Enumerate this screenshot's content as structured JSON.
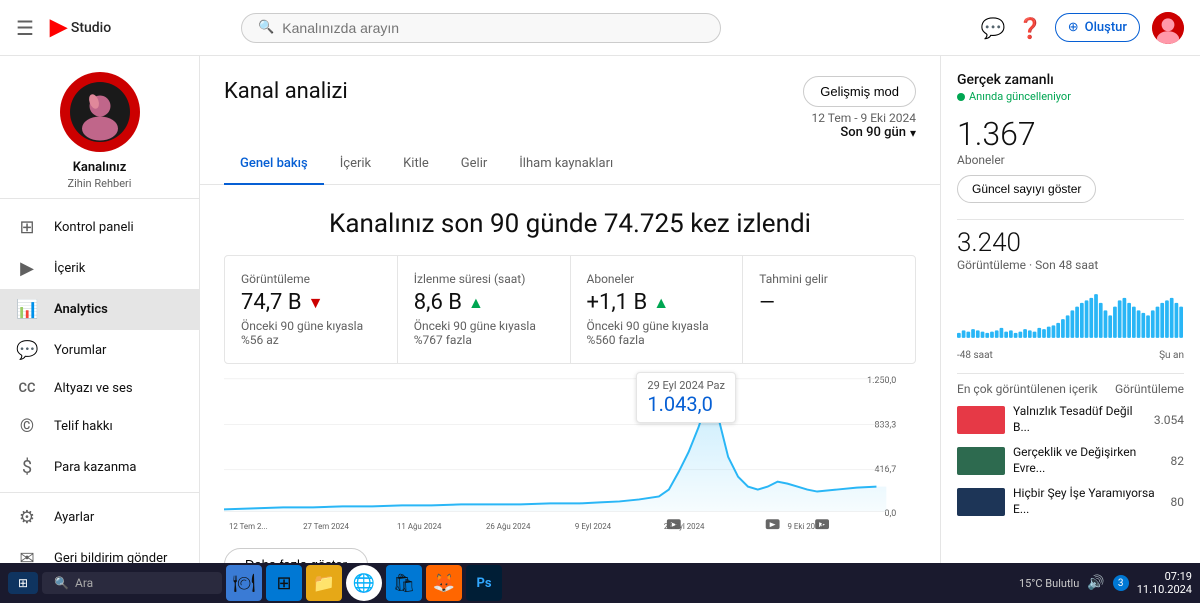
{
  "topbar": {
    "search_placeholder": "Kanalınızda arayın",
    "create_label": "Oluştur",
    "messages_icon": "💬",
    "help_icon": "?",
    "create_icon": "+"
  },
  "sidebar": {
    "channel_name": "Kanalınız",
    "channel_sub": "Zihin Rehberi",
    "items": [
      {
        "id": "dashboard",
        "label": "Kontrol paneli",
        "icon": "⊞"
      },
      {
        "id": "content",
        "label": "İçerik",
        "icon": "▶"
      },
      {
        "id": "analytics",
        "label": "Analytics",
        "icon": "📊"
      },
      {
        "id": "comments",
        "label": "Yorumlar",
        "icon": "💬"
      },
      {
        "id": "subtitles",
        "label": "Altyazı ve ses",
        "icon": "CC"
      },
      {
        "id": "copyright",
        "label": "Telif hakkı",
        "icon": "©"
      },
      {
        "id": "monetization",
        "label": "Para kazanma",
        "icon": "$"
      },
      {
        "id": "settings",
        "label": "Ayarlar",
        "icon": "⚙"
      },
      {
        "id": "feedback",
        "label": "Geri bildirim gönder",
        "icon": "✉"
      }
    ]
  },
  "analytics": {
    "title": "Kanal analizi",
    "advanced_btn": "Gelişmiş mod",
    "tabs": [
      "Genel bakış",
      "İçerik",
      "Kitle",
      "Gelir",
      "İlham kaynakları"
    ],
    "active_tab": "Genel bakış",
    "date_range_label": "12 Tem - 9 Eki 2024",
    "date_range_value": "Son 90 gün",
    "headline": "Kanalınız son 90 günde 74.725 kez izlendi",
    "stats": [
      {
        "label": "Görüntüleme",
        "value": "74,7 B",
        "badge": "down",
        "change": "Önceki 90 güne kıyasla %56 az"
      },
      {
        "label": "İzlenme süresi (saat)",
        "value": "8,6 B",
        "badge": "up",
        "change": "Önceki 90 güne kıyasla %767 fazla"
      },
      {
        "label": "Aboneler",
        "value": "+1,1 B",
        "badge": "up",
        "change": "Önceki 90 güne kıyasla %560 fazla"
      },
      {
        "label": "Tahmini gelir",
        "value": "—",
        "badge": "",
        "change": ""
      }
    ],
    "chart": {
      "tooltip_date": "29 Eyl 2024 Paz",
      "tooltip_value": "1.043,0",
      "x_labels": [
        "12 Tem 2...",
        "27 Tem 2024",
        "11 Ağu 2024",
        "26 Ağu 2024",
        "9 Eyl 2024",
        "24 Eyl 2024",
        "9 Eki 2024"
      ],
      "y_labels": [
        "1.250,0",
        "833,3",
        "416,7",
        "0,0"
      ]
    },
    "show_more": "Daha fazla göster"
  },
  "realtime": {
    "title": "Gerçek zamanlı",
    "subtitle": "Anında güncelleniyor",
    "subs_count": "1.367",
    "subs_label": "Aboneler",
    "update_btn": "Güncel sayıyı göster",
    "views_count": "3.240",
    "views_label": "Görüntüleme · Son 48 saat",
    "chart_label_left": "-48 saat",
    "chart_label_right": "Şu an",
    "content_header_left": "En çok görüntülenen içerik",
    "content_header_right": "Görüntüleme",
    "content_items": [
      {
        "title": "Yalnızlık Tesadüf Değil B...",
        "views": "3.054",
        "color": "#e63946"
      },
      {
        "title": "Gerçeklik ve Değişirken Evre...",
        "views": "82",
        "color": "#2d6a4f"
      },
      {
        "title": "Hiçbir Şey İşe Yaramıyorsa E...",
        "views": "80",
        "color": "#1d3557"
      }
    ]
  },
  "taskbar": {
    "search_placeholder": "Ara",
    "time": "07:19",
    "date": "11.10.2024",
    "weather": "15°C  Bulutlu",
    "notification": "3"
  }
}
